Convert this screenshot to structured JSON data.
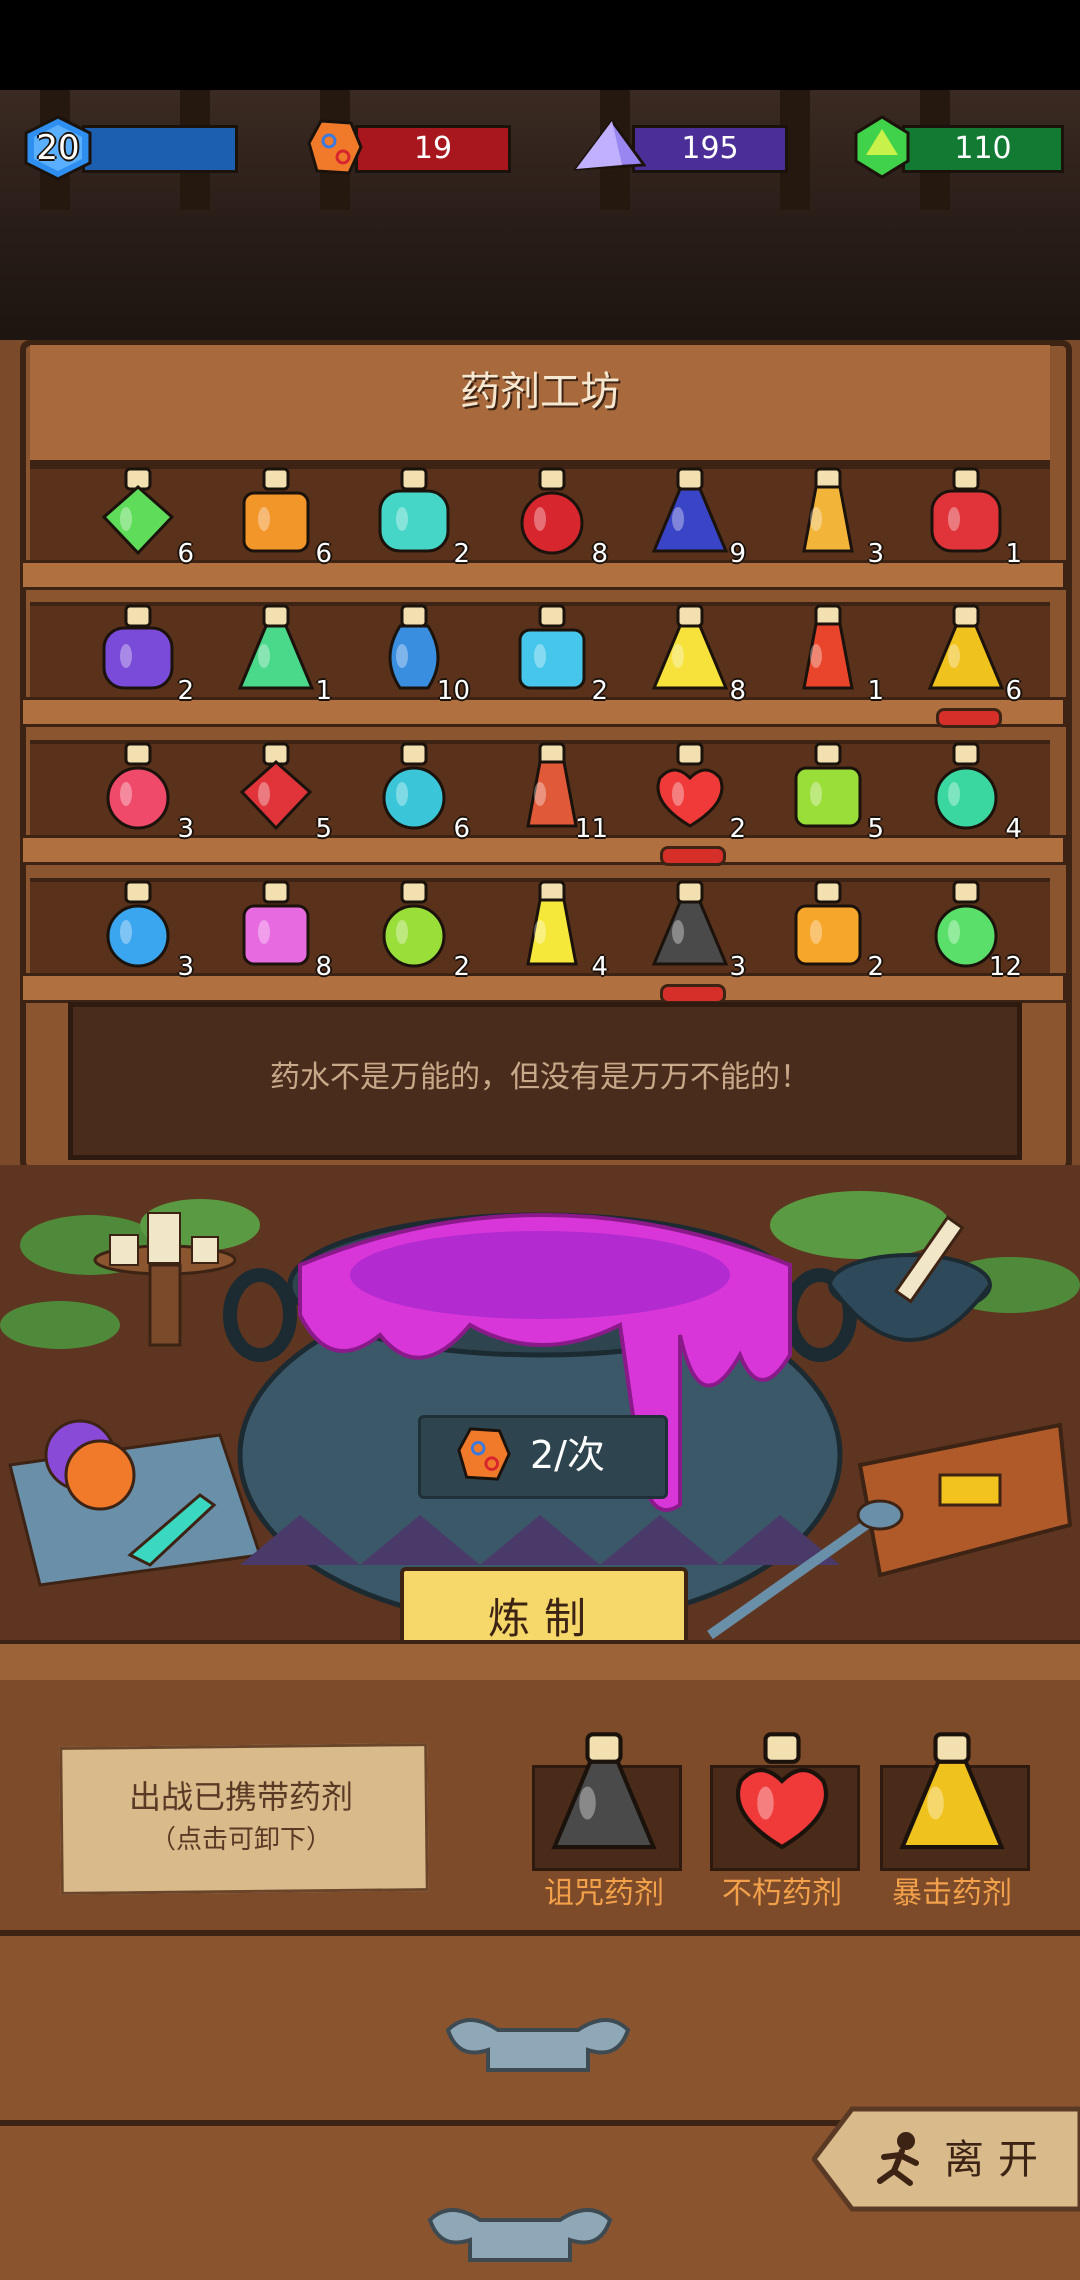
{
  "resources": {
    "level": {
      "value": "20",
      "color": "#1c5fb0"
    },
    "red_gem": {
      "value": "19",
      "color": "#a8161e"
    },
    "purple_crystal": {
      "value": "195",
      "color": "#4b2e98"
    },
    "green_gem": {
      "value": "110",
      "color": "#137a33"
    }
  },
  "workshop": {
    "title": "药剂工坊",
    "shelves": [
      [
        {
          "count": "6",
          "color": "#5fdc5a",
          "icon": "diamond-potion"
        },
        {
          "count": "6",
          "color": "#f3962a",
          "icon": "square-potion"
        },
        {
          "count": "2",
          "color": "#46d6c8",
          "icon": "jar-potion"
        },
        {
          "count": "8",
          "color": "#d8262e",
          "icon": "round-potion"
        },
        {
          "count": "9",
          "color": "#3a44c6",
          "icon": "flask-potion"
        },
        {
          "count": "3",
          "color": "#f2b53a",
          "icon": "bottle-potion"
        },
        {
          "count": "1",
          "color": "#e0343a",
          "icon": "jar-potion"
        }
      ],
      [
        {
          "count": "2",
          "color": "#7a4ad8",
          "icon": "jar-potion"
        },
        {
          "count": "1",
          "color": "#4ad88a",
          "icon": "flask-potion"
        },
        {
          "count": "10",
          "color": "#3a8ee0",
          "icon": "vase-potion"
        },
        {
          "count": "2",
          "color": "#46c6ea",
          "icon": "square-potion"
        },
        {
          "count": "8",
          "color": "#f6e23a",
          "icon": "flask-potion"
        },
        {
          "count": "1",
          "color": "#e8452a",
          "icon": "bottle-potion"
        },
        {
          "count": "6",
          "color": "#f0c21e",
          "icon": "flask-potion",
          "equipped": true
        }
      ],
      [
        {
          "count": "3",
          "color": "#f04a6a",
          "icon": "round-potion"
        },
        {
          "count": "5",
          "color": "#e0343a",
          "icon": "diamond-potion"
        },
        {
          "count": "6",
          "color": "#3ac6d8",
          "icon": "round-potion"
        },
        {
          "count": "11",
          "color": "#e05a3a",
          "icon": "bottle-potion"
        },
        {
          "count": "2",
          "color": "#f03a3a",
          "icon": "heart-potion",
          "equipped": true
        },
        {
          "count": "5",
          "color": "#9ade3a",
          "icon": "square-potion"
        },
        {
          "count": "4",
          "color": "#3ad8a0",
          "icon": "round-potion"
        }
      ],
      [
        {
          "count": "3",
          "color": "#3aa6f0",
          "icon": "round-potion"
        },
        {
          "count": "8",
          "color": "#e86ae0",
          "icon": "square-potion"
        },
        {
          "count": "2",
          "color": "#9ade3a",
          "icon": "round-potion"
        },
        {
          "count": "4",
          "color": "#f6e83a",
          "icon": "bottle-potion"
        },
        {
          "count": "3",
          "color": "#4a4a4a",
          "icon": "flask-potion",
          "equipped": true
        },
        {
          "count": "2",
          "color": "#f6a62a",
          "icon": "square-potion"
        },
        {
          "count": "12",
          "color": "#5ae06a",
          "icon": "round-potion"
        }
      ]
    ],
    "quote": "药水不是万能的，但没有是万万不能的！"
  },
  "brew": {
    "cost": "2/次",
    "button_label": "炼制"
  },
  "carried": {
    "title": "出战已携带药剂",
    "hint": "（点击可卸下）",
    "potions": [
      {
        "label": "诅咒药剂",
        "color": "#4a4a4a"
      },
      {
        "label": "不朽药剂",
        "color": "#f03a3a"
      },
      {
        "label": "暴击药剂",
        "color": "#f0c21e"
      }
    ]
  },
  "leave": {
    "label": "离开"
  }
}
